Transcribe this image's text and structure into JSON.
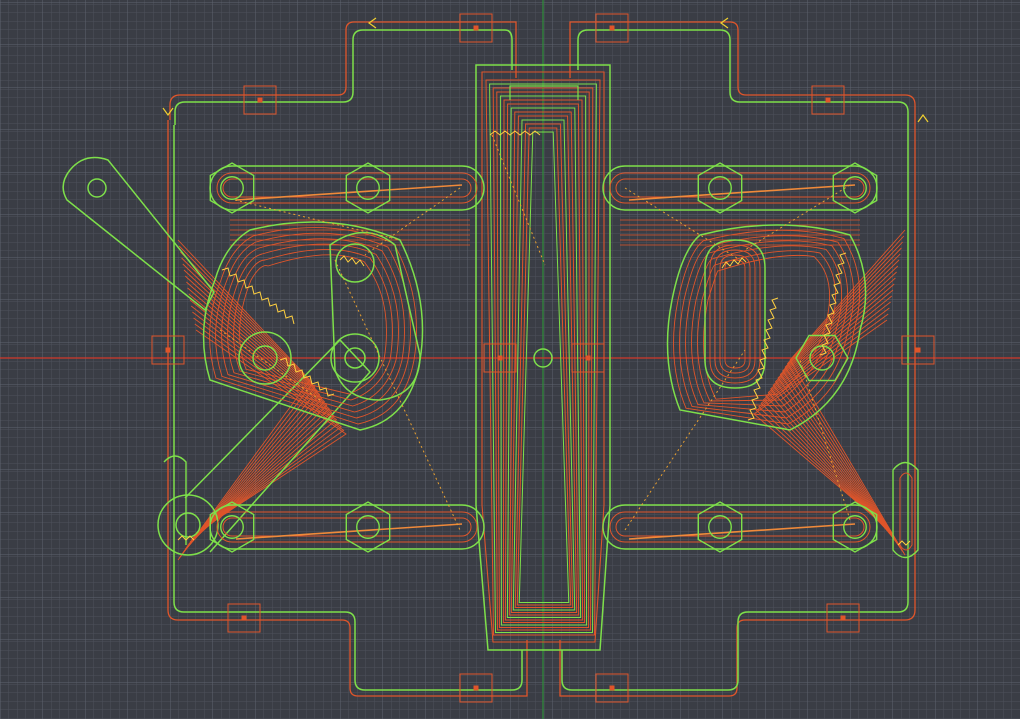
{
  "canvas": {
    "background": "#3a3d45",
    "grid_minor_color": "#4d515b",
    "grid_major_color": "#626773",
    "axis_x_color": "#d23a2a",
    "axis_y_color": "#2f8f3a"
  },
  "colors": {
    "outline": "#7ee04a",
    "toolpath": "#e0552a",
    "toolpath_light": "#f08a3a",
    "rapid": "#e8a030",
    "zigzag": "#ffd040",
    "marker": "#e0552a"
  },
  "parts": [
    {
      "name": "frame-plate",
      "kind": "outline"
    },
    {
      "name": "center-tapered-bar",
      "kind": "outline"
    },
    {
      "name": "left-swing-arm",
      "kind": "outline"
    },
    {
      "name": "left-top-link",
      "kind": "outline"
    },
    {
      "name": "left-bottom-link",
      "kind": "outline"
    },
    {
      "name": "left-cam-plate",
      "kind": "outline"
    },
    {
      "name": "right-top-link",
      "kind": "outline"
    },
    {
      "name": "right-bottom-link",
      "kind": "outline"
    },
    {
      "name": "right-cam-plate",
      "kind": "outline"
    }
  ],
  "tab_markers": 12
}
